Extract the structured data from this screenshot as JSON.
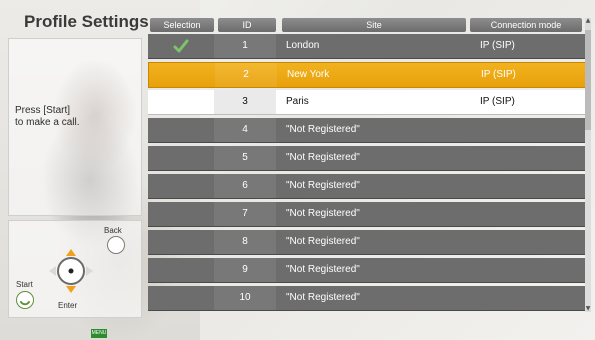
{
  "title": "Profile Settings",
  "info": {
    "line1": "Press [Start]",
    "line2": "to make a call."
  },
  "controls": {
    "back_label": "Back",
    "start_label": "Start",
    "enter_label": "Enter",
    "menu_label": "MENU"
  },
  "table": {
    "headers": [
      "Selection",
      "ID",
      "Site",
      "Connection mode"
    ],
    "rows": [
      {
        "selected": true,
        "id": "1",
        "site": "London",
        "mode": "IP (SIP)",
        "style": "gray"
      },
      {
        "selected": false,
        "id": "2",
        "site": "New York",
        "mode": "IP (SIP)",
        "style": "orange"
      },
      {
        "selected": false,
        "id": "3",
        "site": "Paris",
        "mode": "IP (SIP)",
        "style": "white"
      },
      {
        "selected": false,
        "id": "4",
        "site": "\"Not Registered\"",
        "mode": "",
        "style": "gray"
      },
      {
        "selected": false,
        "id": "5",
        "site": "\"Not Registered\"",
        "mode": "",
        "style": "gray"
      },
      {
        "selected": false,
        "id": "6",
        "site": "\"Not Registered\"",
        "mode": "",
        "style": "gray"
      },
      {
        "selected": false,
        "id": "7",
        "site": "\"Not Registered\"",
        "mode": "",
        "style": "gray"
      },
      {
        "selected": false,
        "id": "8",
        "site": "\"Not Registered\"",
        "mode": "",
        "style": "gray"
      },
      {
        "selected": false,
        "id": "9",
        "site": "\"Not Registered\"",
        "mode": "",
        "style": "gray"
      },
      {
        "selected": false,
        "id": "10",
        "site": "\"Not Registered\"",
        "mode": "",
        "style": "gray"
      }
    ]
  },
  "colors": {
    "highlight": "#E8A10B",
    "row_gray": "#6D6D6D",
    "check": "#7CC36A",
    "menu_tag": "#2E8B2E"
  }
}
